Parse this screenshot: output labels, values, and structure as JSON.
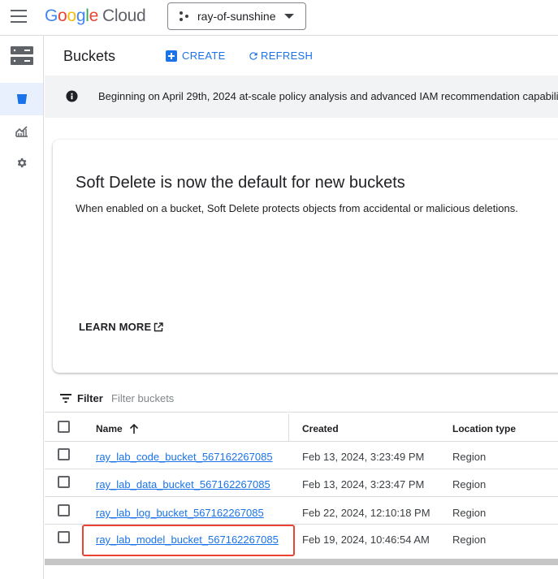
{
  "topbar": {
    "logo_letters": [
      "G",
      "o",
      "o",
      "g",
      "l",
      "e"
    ],
    "logo_suffix": "Cloud",
    "project_name": "ray-of-sunshine"
  },
  "rail": {
    "items": [
      {
        "icon": "storage-icon",
        "active": false
      },
      {
        "icon": "bucket-icon",
        "active": true
      },
      {
        "icon": "monitoring-icon",
        "active": false
      },
      {
        "icon": "settings-icon",
        "active": false
      }
    ]
  },
  "header": {
    "title": "Buckets",
    "create_label": "CREATE",
    "refresh_label": "REFRESH"
  },
  "banner": {
    "text": "Beginning on April 29th, 2024 at-scale policy analysis and advanced IAM recommendation capabili"
  },
  "card": {
    "title": "Soft Delete is now the default for new buckets",
    "description": "When enabled on a bucket, Soft Delete protects objects from accidental or malicious deletions.",
    "learn_more": "LEARN MORE"
  },
  "filter": {
    "label": "Filter",
    "placeholder": "Filter buckets"
  },
  "table": {
    "headers": {
      "name": "Name",
      "created": "Created",
      "location_type": "Location type"
    },
    "rows": [
      {
        "name": "ray_lab_code_bucket_567162267085",
        "created": "Feb 13, 2024, 3:23:49 PM",
        "location_type": "Region"
      },
      {
        "name": "ray_lab_data_bucket_567162267085",
        "created": "Feb 13, 2024, 3:23:47 PM",
        "location_type": "Region"
      },
      {
        "name": "ray_lab_log_bucket_567162267085",
        "created": "Feb 22, 2024, 12:10:18 PM",
        "location_type": "Region"
      },
      {
        "name": "ray_lab_model_bucket_567162267085",
        "created": "Feb 19, 2024, 10:46:54 AM",
        "location_type": "Region"
      }
    ]
  },
  "colors": {
    "accent": "#1a73e8",
    "highlight": "#ea4335",
    "banner_bg": "#f1f3f4"
  }
}
